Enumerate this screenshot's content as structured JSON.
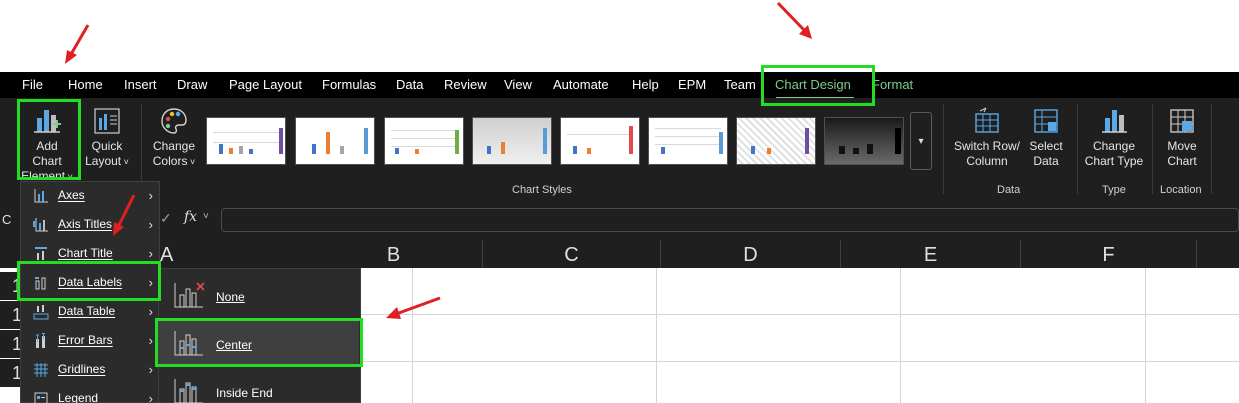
{
  "menu": {
    "tabs": [
      "File",
      "Home",
      "Insert",
      "Draw",
      "Page Layout",
      "Formulas",
      "Data",
      "Review",
      "View",
      "Automate",
      "Help",
      "EPM",
      "Team",
      "Chart Design",
      "Format"
    ],
    "active_tab": "Chart Design"
  },
  "ribbon": {
    "add_chart_element": [
      "Add Chart",
      "Element"
    ],
    "quick_layout": [
      "Quick",
      "Layout"
    ],
    "change_colors": [
      "Change",
      "Colors"
    ],
    "chart_styles_label": "Chart Styles",
    "switch_row_column": [
      "Switch Row/",
      "Column"
    ],
    "select_data": [
      "Select",
      "Data"
    ],
    "data_group_label": "Data",
    "change_chart_type": [
      "Change",
      "Chart Type"
    ],
    "type_group_label": "Type",
    "move_chart": [
      "Move",
      "Chart"
    ],
    "location_group_label": "Location"
  },
  "formula_bar": {
    "name_box": "C",
    "fx": "fx"
  },
  "columns": [
    "A",
    "B",
    "C",
    "D",
    "E",
    "F"
  ],
  "rows": [
    "1",
    "1",
    "1",
    "1"
  ],
  "dropdown": {
    "items": [
      {
        "label": "Axes",
        "icon": "axes-icon"
      },
      {
        "label": "Axis Titles",
        "icon": "axis-titles-icon"
      },
      {
        "label": "Chart Title",
        "icon": "chart-title-icon"
      },
      {
        "label": "Data Labels",
        "icon": "data-labels-icon"
      },
      {
        "label": "Data Table",
        "icon": "data-table-icon"
      },
      {
        "label": "Error Bars",
        "icon": "error-bars-icon"
      },
      {
        "label": "Gridlines",
        "icon": "gridlines-icon"
      },
      {
        "label": "Legend",
        "icon": "legend-icon"
      }
    ]
  },
  "submenu": {
    "items": [
      {
        "label": "None",
        "icon": "data-labels-none-icon"
      },
      {
        "label": "Center",
        "icon": "data-labels-center-icon"
      },
      {
        "label": "Inside End",
        "icon": "data-labels-inside-end-icon"
      }
    ]
  },
  "colors": {
    "accent": "#7ecb8f",
    "highlight": "#22dd22",
    "annotation_arrow": "#e02020"
  }
}
